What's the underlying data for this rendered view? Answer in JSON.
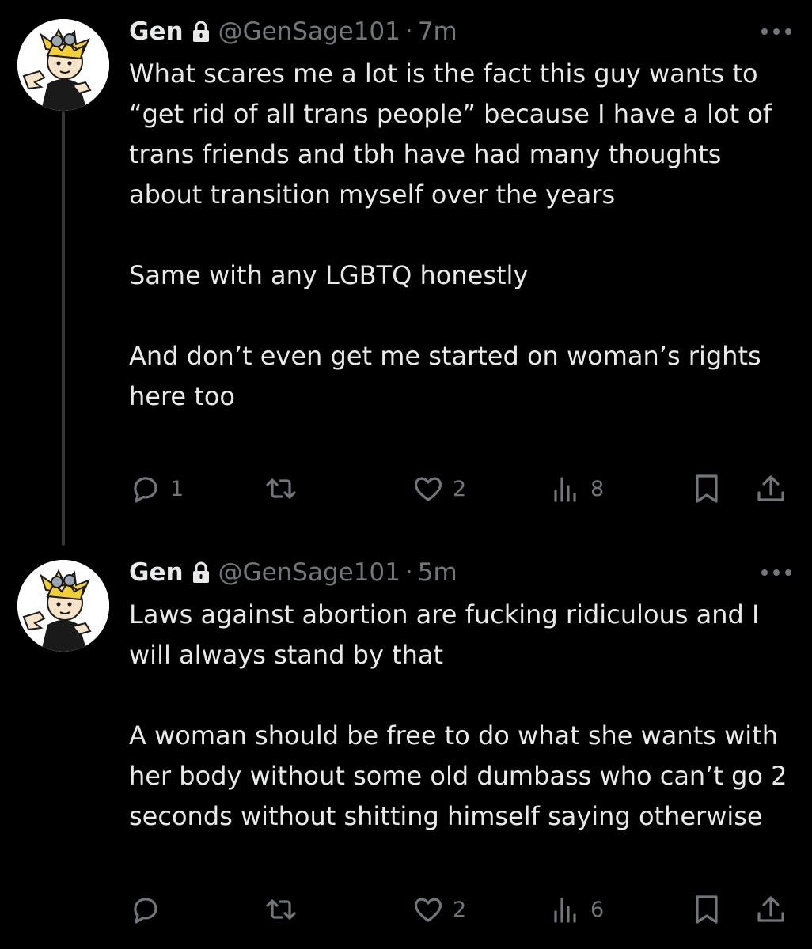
{
  "tweets": [
    {
      "author_name": "Gen",
      "handle": "@GenSage101",
      "separator": "·",
      "time": "7m",
      "paragraphs": [
        "What scares me a lot is the fact this guy wants to “get rid of all trans people” because I have a lot of trans friends and tbh have had many thoughts about transition myself over the years",
        "Same with any LGBTQ honestly",
        "And don’t even get me started on woman’s rights here too"
      ],
      "reply_count": "1",
      "retweet_count": "",
      "like_count": "2",
      "view_count": "8"
    },
    {
      "author_name": "Gen",
      "handle": "@GenSage101",
      "separator": "·",
      "time": "5m",
      "paragraphs": [
        "Laws against abortion are fucking ridiculous and I will always stand by that",
        "A woman should be free to do what she wants with her body without some old dumbass who can’t go 2 seconds without shitting himself saying otherwise"
      ],
      "reply_count": "",
      "retweet_count": "",
      "like_count": "2",
      "view_count": "6"
    }
  ],
  "icons": {
    "lock": "lock-icon",
    "more": "more-icon",
    "reply": "reply-icon",
    "retweet": "retweet-icon",
    "like": "heart-icon",
    "views": "views-icon",
    "bookmark": "bookmark-icon",
    "share": "share-icon"
  },
  "colors": {
    "background": "#000000",
    "text": "#e7e9ea",
    "muted": "#71767b",
    "thread_line": "#333639"
  }
}
